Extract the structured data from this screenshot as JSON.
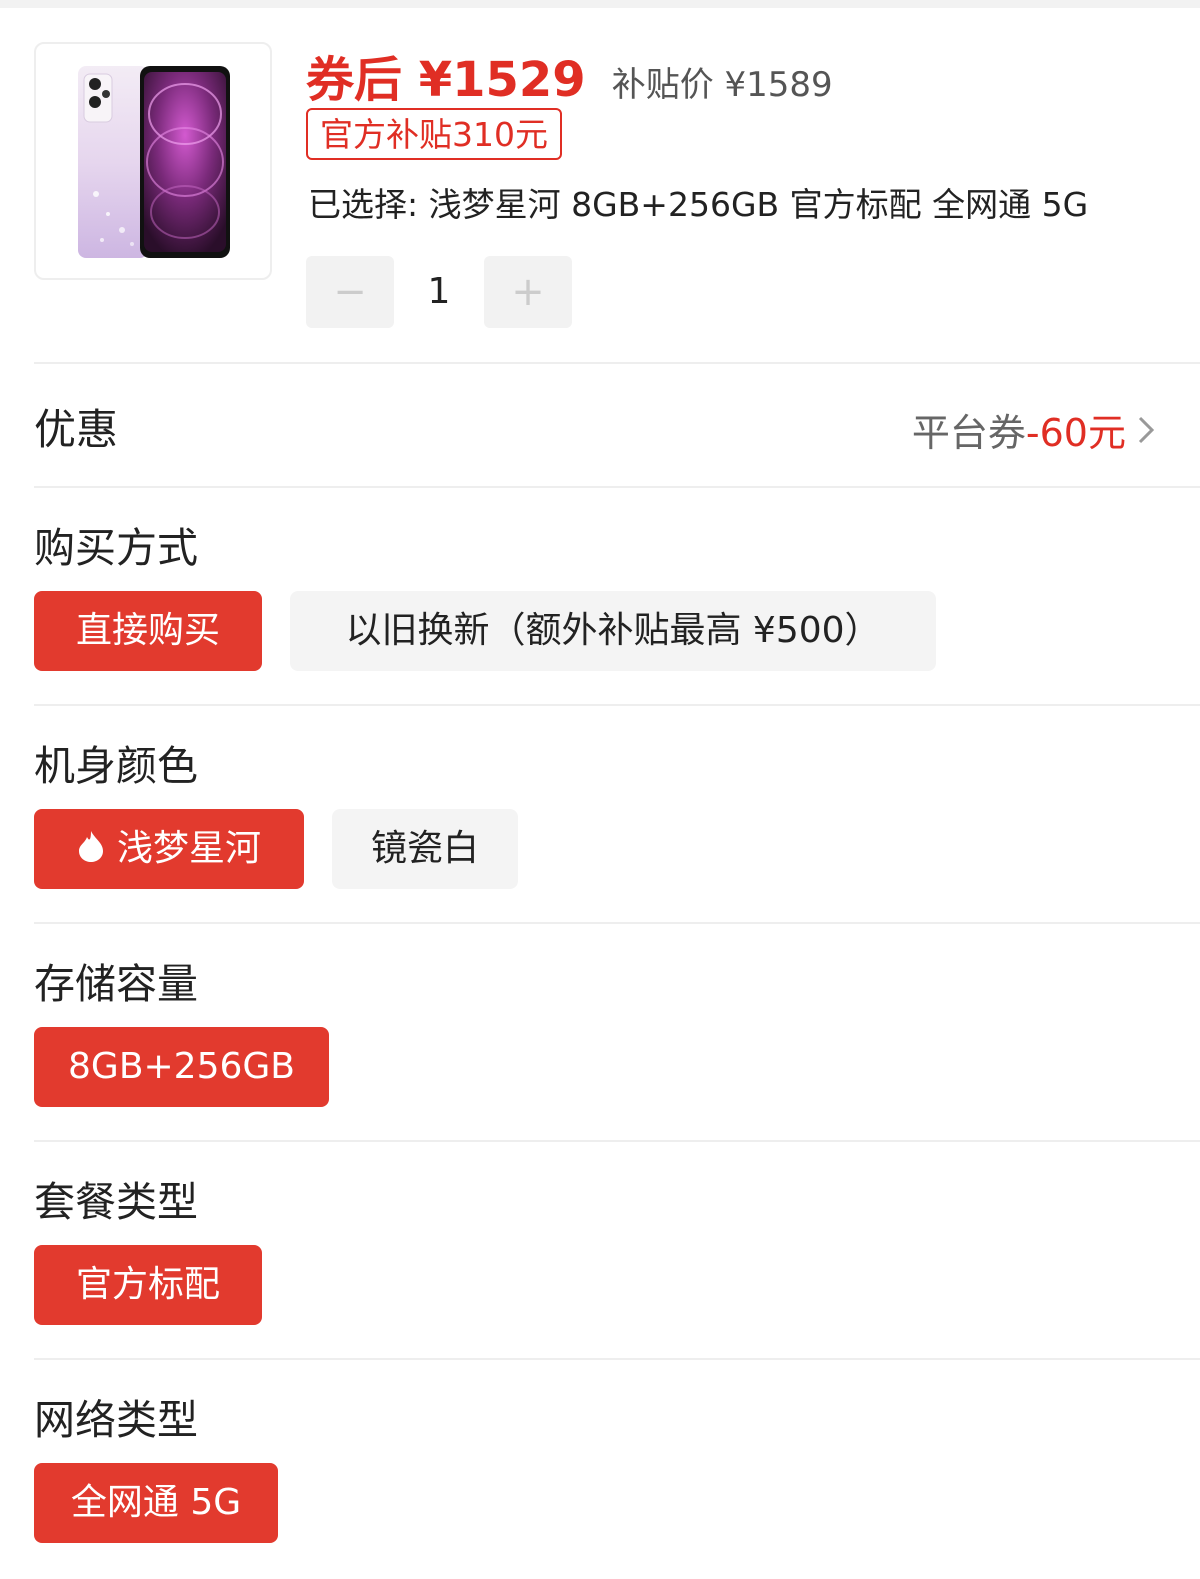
{
  "product": {
    "image_alt": "手机图片",
    "price_after_coupon": "券后 ¥1529",
    "subsidy_price": "补贴价 ¥1589",
    "subsidy_badge": "官方补贴310元",
    "selected_line": "已选择: 浅梦星河 8GB+256GB 官方标配 全网通 5G",
    "quantity": "1",
    "minus_symbol": "−",
    "plus_symbol": "+"
  },
  "discount": {
    "label": "优惠",
    "coupon_text": "平台券",
    "coupon_value": "-60元"
  },
  "sections": {
    "purchase": {
      "title": "购买方式",
      "options": [
        {
          "label": "直接购买",
          "selected": true
        },
        {
          "label": "以旧换新（额外补贴最高 ¥500）",
          "selected": false
        }
      ]
    },
    "color": {
      "title": "机身颜色",
      "options": [
        {
          "label": "浅梦星河",
          "selected": true,
          "icon": "flame-icon"
        },
        {
          "label": "镜瓷白",
          "selected": false
        }
      ]
    },
    "storage": {
      "title": "存储容量",
      "options": [
        {
          "label": "8GB+256GB",
          "selected": true
        }
      ]
    },
    "package": {
      "title": "套餐类型",
      "options": [
        {
          "label": "官方标配",
          "selected": true
        }
      ]
    },
    "network": {
      "title": "网络类型",
      "options": [
        {
          "label": "全网通 5G",
          "selected": true
        }
      ]
    }
  },
  "colors": {
    "accent_red": "#e23a2e",
    "price_red": "#e02e24",
    "chip_gray": "#f4f4f4",
    "divider": "#eeeeee"
  }
}
